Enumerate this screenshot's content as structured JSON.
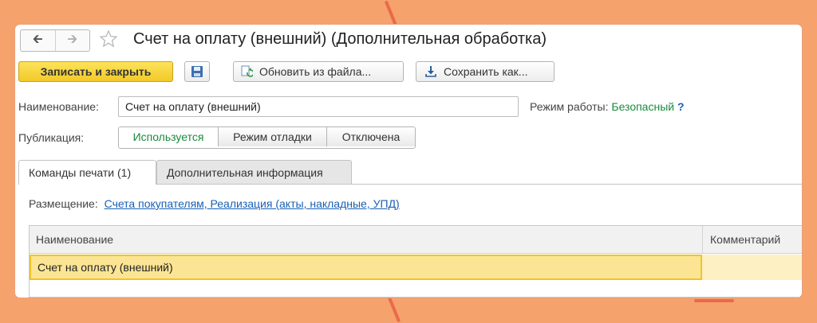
{
  "window": {
    "title": "Счет на оплату (внешний) (Дополнительная обработка)"
  },
  "toolbar": {
    "save_close_label": "Записать и закрыть",
    "update_from_file_label": "Обновить из файла...",
    "save_as_label": "Сохранить как..."
  },
  "form": {
    "name_label": "Наименование:",
    "name_value": "Счет на оплату (внешний)",
    "mode_label": "Режим работы:",
    "mode_value": "Безопасный",
    "help_label": "?",
    "publication_label": "Публикация:",
    "publication_options": [
      "Используется",
      "Режим отладки",
      "Отключена"
    ],
    "publication_selected": "Используется"
  },
  "tabs": [
    {
      "label": "Команды печати (1)",
      "active": true
    },
    {
      "label": "Дополнительная информация",
      "active": false
    }
  ],
  "placement": {
    "label": "Размещение:",
    "value": "Счета покупателям, Реализация (акты, накладные, УПД)"
  },
  "table": {
    "columns": [
      "Наименование",
      "Комментарий"
    ],
    "rows": [
      {
        "name": "Счет на оплату (внешний)",
        "comment": ""
      }
    ]
  },
  "colors": {
    "background": "#f6a26d",
    "primary_button": "#f2c928",
    "active_green": "#1a8a3c",
    "link_blue": "#1a5fb4",
    "selected_row": "#fbe594"
  }
}
